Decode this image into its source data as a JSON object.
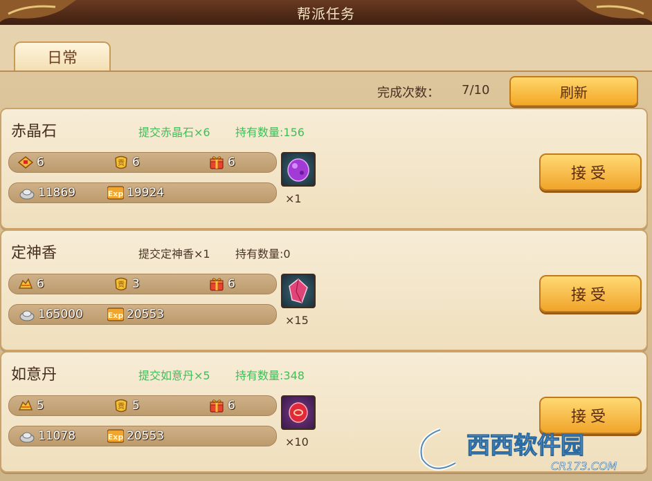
{
  "window": {
    "title": "帮派任务"
  },
  "tabs": [
    {
      "label": "日常"
    }
  ],
  "status": {
    "label": "完成次数：",
    "count": "7/10",
    "refresh_label": "刷新"
  },
  "tasks": [
    {
      "name": "赤晶石",
      "submit_text": "提交赤晶石×6",
      "owned_text": "持有数量:156",
      "text_color": "#3fbe57",
      "rewards_row1": [
        {
          "icon": "red-envelope-icon",
          "value": "6"
        },
        {
          "icon": "contribution-icon",
          "value": "6"
        },
        {
          "icon": "gift-box-icon",
          "value": "6"
        }
      ],
      "rewards_row2": [
        {
          "icon": "silver-ingot-icon",
          "value": "11869"
        },
        {
          "icon": "exp-icon",
          "value": "19924"
        }
      ],
      "reward_item": {
        "icon": "purple-orb-icon",
        "qty": "×1"
      },
      "accept_label": "接受"
    },
    {
      "name": "定神香",
      "submit_text": "提交定神香×1",
      "owned_text": "持有数量:0",
      "text_color": "#4a3425",
      "rewards_row1": [
        {
          "icon": "gold-pouch-icon",
          "value": "6"
        },
        {
          "icon": "contribution-icon",
          "value": "3"
        },
        {
          "icon": "gift-box-icon",
          "value": "6"
        }
      ],
      "rewards_row2": [
        {
          "icon": "silver-ingot-icon",
          "value": "165000"
        },
        {
          "icon": "exp-icon",
          "value": "20553"
        }
      ],
      "reward_item": {
        "icon": "pink-crystal-icon",
        "qty": "×15"
      },
      "accept_label": "接受"
    },
    {
      "name": "如意丹",
      "submit_text": "提交如意丹×5",
      "owned_text": "持有数量:348",
      "text_color": "#3fbe57",
      "rewards_row1": [
        {
          "icon": "gold-pouch-icon",
          "value": "5"
        },
        {
          "icon": "contribution-icon",
          "value": "5"
        },
        {
          "icon": "gift-box-icon",
          "value": "6"
        }
      ],
      "rewards_row2": [
        {
          "icon": "silver-ingot-icon",
          "value": "11078"
        },
        {
          "icon": "exp-icon",
          "value": "20553"
        }
      ],
      "reward_item": {
        "icon": "red-pill-icon",
        "qty": "×10"
      },
      "accept_label": "接受"
    }
  ],
  "watermark": {
    "brand": "西西软件园",
    "url": "CR173.COM"
  }
}
